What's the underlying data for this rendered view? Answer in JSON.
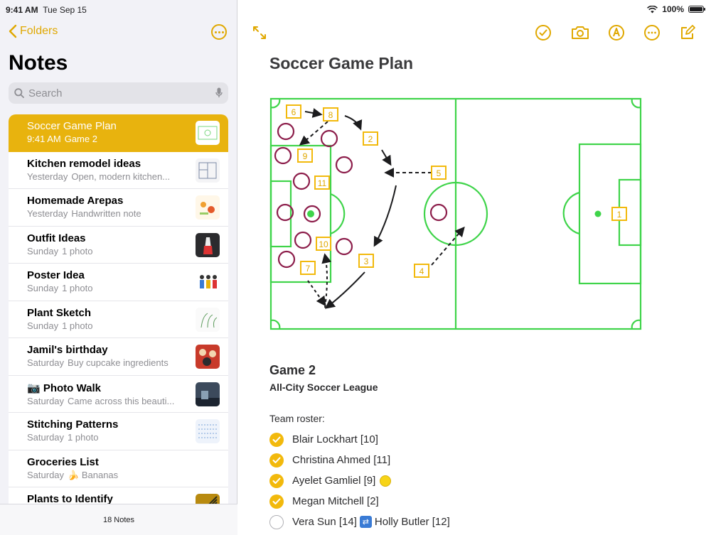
{
  "status": {
    "time": "9:41 AM",
    "date": "Tue Sep 15",
    "battery": "100%"
  },
  "sidebar": {
    "back_label": "Folders",
    "title": "Notes",
    "search_placeholder": "Search",
    "notes": [
      {
        "title": "Soccer Game Plan",
        "date": "9:41 AM",
        "preview": "Game 2",
        "thumb": "sketch",
        "selected": true
      },
      {
        "title": "Kitchen remodel ideas",
        "date": "Yesterday",
        "preview": "Open, modern kitchen...",
        "thumb": "plan"
      },
      {
        "title": "Homemade Arepas",
        "date": "Yesterday",
        "preview": "Handwritten note",
        "thumb": "recipe"
      },
      {
        "title": "Outfit Ideas",
        "date": "Sunday",
        "preview": "1 photo",
        "thumb": "outfit"
      },
      {
        "title": "Poster Idea",
        "date": "Sunday",
        "preview": "1 photo",
        "thumb": "poster"
      },
      {
        "title": "Plant Sketch",
        "date": "Sunday",
        "preview": "1 photo",
        "thumb": "plant"
      },
      {
        "title": "Jamil's birthday",
        "date": "Saturday",
        "preview": "Buy cupcake ingredients",
        "thumb": "cupcake"
      },
      {
        "title": "📷 Photo Walk",
        "date": "Saturday",
        "preview": "Came across this beauti...",
        "thumb": "photo"
      },
      {
        "title": "Stitching Patterns",
        "date": "Saturday",
        "preview": "1 photo",
        "thumb": "stitch"
      },
      {
        "title": "Groceries List",
        "date": "Saturday",
        "preview": "🍌 Bananas",
        "thumb": ""
      },
      {
        "title": "Plants to Identify",
        "date": "",
        "preview": "",
        "thumb": "leaf"
      }
    ],
    "footer": "18 Notes"
  },
  "toolbar": {
    "icons": [
      "expand-icon",
      "checklist-icon",
      "camera-icon",
      "markup-pen-icon",
      "more-icon",
      "compose-icon"
    ],
    "accent": "#e0a800"
  },
  "note": {
    "title": "Soccer Game Plan",
    "heading": "Game 2",
    "subheading": "All-City Soccer League",
    "roster_label": "Team roster:",
    "roster": [
      {
        "text": "Blair Lockhart [10]",
        "checked": true
      },
      {
        "text": "Christina Ahmed [11]",
        "checked": true
      },
      {
        "text": "Ayelet Gamliel [9]",
        "checked": true,
        "emoji": "soccer"
      },
      {
        "text": "Megan Mitchell [2]",
        "checked": true
      },
      {
        "text": "Vera Sun [14]",
        "checked": false,
        "swap": "Holly Butler [12]"
      }
    ],
    "sketch_labels": [
      "6",
      "8",
      "2",
      "9",
      "5",
      "11",
      "10",
      "3",
      "7",
      "4",
      "1"
    ]
  }
}
